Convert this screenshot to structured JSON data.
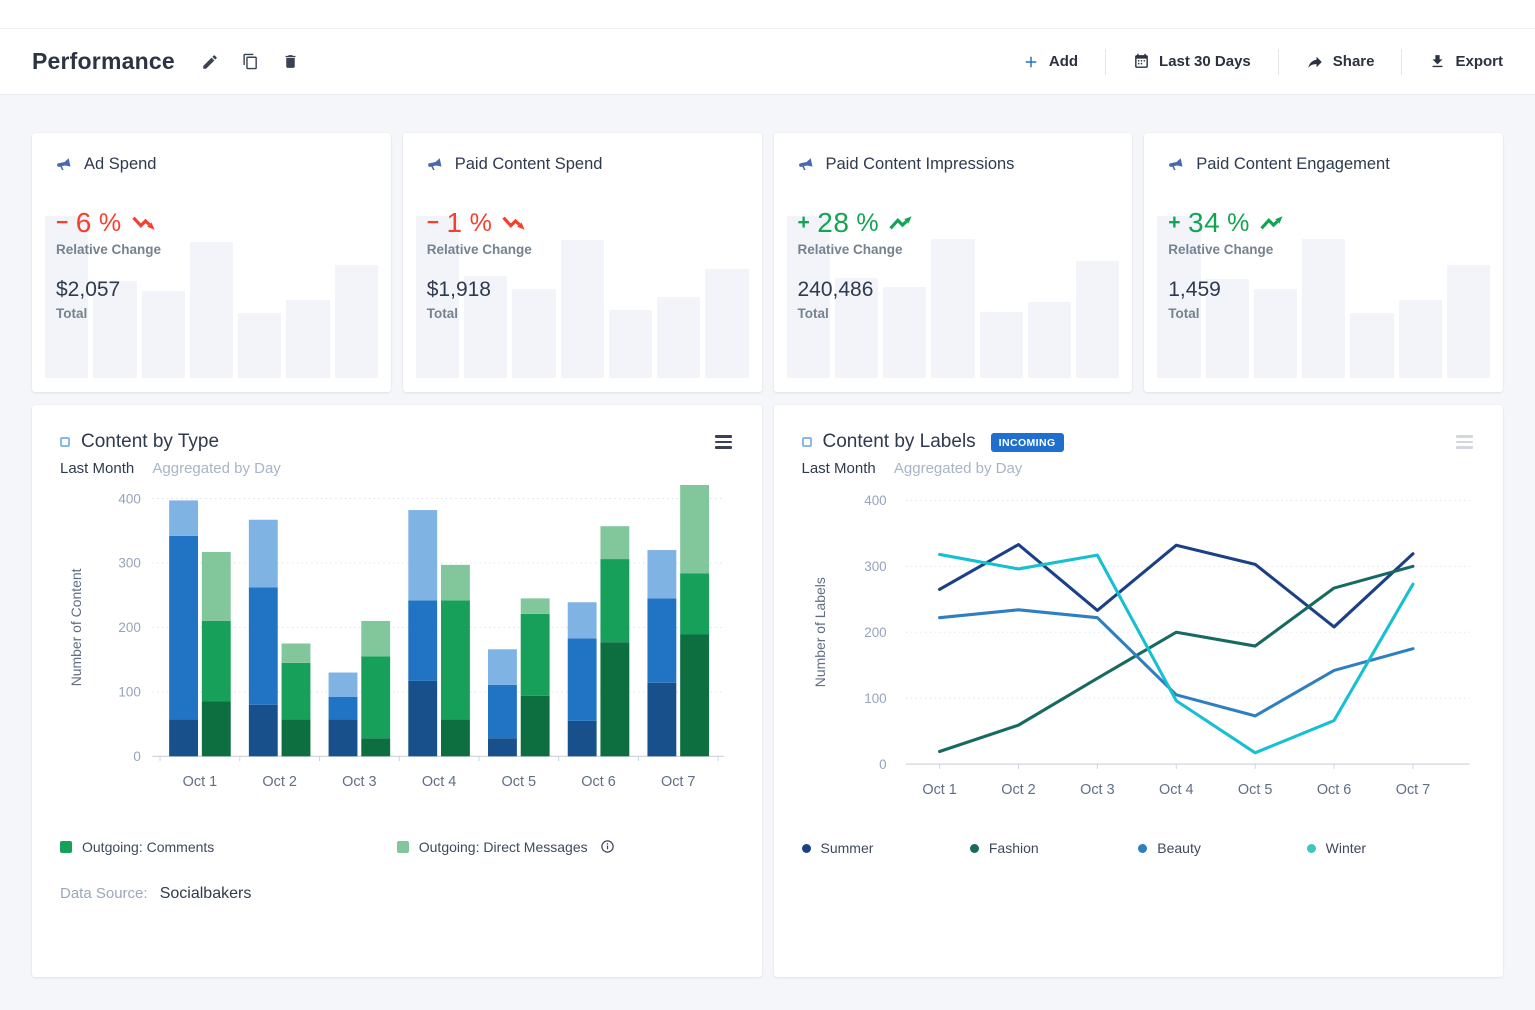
{
  "header": {
    "title": "Performance",
    "actions": {
      "add": "Add",
      "date_range": "Last 30 Days",
      "share": "Share",
      "export": "Export"
    }
  },
  "colors": {
    "accent_blue": "#2173c4",
    "negative_red": "#f4402f",
    "positive_green": "#13a453",
    "badge_blue": "#1e6fce",
    "kpi_icon_blue": "#4a69ad",
    "spark_gray": "#f2f4f9"
  },
  "icons": {
    "edit": "pencil",
    "duplicate": "two-overlapping-squares",
    "delete": "trash-can",
    "add": "plus",
    "date_range": "calendar",
    "share": "curved-arrow-right",
    "export": "download-arrow",
    "kpi": "megaphone",
    "chart_menu": "hamburger",
    "widget_select": "outlined-square",
    "info": "circled-i",
    "trend_down": "zigzag-arrow-down",
    "trend_up": "zigzag-arrow-up"
  },
  "kpi_cards": [
    {
      "title": "Ad Spend",
      "sign": "−",
      "value": "6",
      "suffix": "%",
      "direction": "down",
      "color": "#f4402f",
      "change_label": "Relative Change",
      "total": "$2,057",
      "total_label": "Total",
      "sparkline": [
        1,
        0.6,
        0.54,
        0.84,
        0.4,
        0.48,
        0.7
      ]
    },
    {
      "title": "Paid Content Spend",
      "sign": "−",
      "value": "1",
      "suffix": "%",
      "direction": "down",
      "color": "#f4402f",
      "change_label": "Relative Change",
      "total": "$1,918",
      "total_label": "Total",
      "sparkline": [
        1,
        0.63,
        0.55,
        0.85,
        0.42,
        0.5,
        0.67
      ]
    },
    {
      "title": "Paid Content Impressions",
      "sign": "+",
      "value": "28",
      "suffix": "%",
      "direction": "up",
      "color": "#13a453",
      "change_label": "Relative Change",
      "total": "240,486",
      "total_label": "Total",
      "sparkline": [
        1,
        0.62,
        0.56,
        0.86,
        0.41,
        0.47,
        0.72
      ]
    },
    {
      "title": "Paid Content Engagement",
      "sign": "+",
      "value": "34",
      "suffix": "%",
      "direction": "up",
      "color": "#13a453",
      "change_label": "Relative Change",
      "total": "1,459",
      "total_label": "Total",
      "sparkline": [
        1,
        0.61,
        0.55,
        0.86,
        0.4,
        0.48,
        0.7
      ]
    }
  ],
  "charts": {
    "content_by_type": {
      "title": "Content by Type",
      "period": "Last Month",
      "aggregation": "Aggregated by Day",
      "legend": [
        {
          "label": "Outgoing: Comments",
          "color": "#16a05a"
        },
        {
          "label": "Outgoing: Direct Messages",
          "color": "#82c79c",
          "info": true
        }
      ],
      "data_source_label": "Data Source:",
      "data_source_value": "Socialbakers"
    },
    "content_by_labels": {
      "title": "Content by Labels",
      "badge": "INCOMING",
      "badge_color": "#1e6fce",
      "period": "Last Month",
      "aggregation": "Aggregated by Day",
      "legend": [
        {
          "label": "Summer",
          "color": "#1c4086"
        },
        {
          "label": "Fashion",
          "color": "#166a60"
        },
        {
          "label": "Beauty",
          "color": "#2d7fc1"
        },
        {
          "label": "Winter",
          "color": "#3cc4c7"
        }
      ]
    }
  },
  "chart_data": [
    {
      "type": "bar",
      "stacked": true,
      "title": "Content by Type",
      "categories": [
        "Oct 1",
        "Oct 2",
        "Oct 3",
        "Oct 4",
        "Oct 5",
        "Oct 6",
        "Oct 7"
      ],
      "ylabel": "Number of Content",
      "ylim": [
        0,
        400
      ],
      "yticks": [
        0,
        100,
        200,
        300,
        400
      ],
      "grid": "dotted-horizontal",
      "groups": [
        {
          "id": "blue-stack",
          "colors": [
            "#17508a",
            "#2173c4",
            "#7fb3e4"
          ],
          "segment_labels": [
            null,
            null,
            null
          ],
          "segments": [
            [
              57,
              80,
              57,
              117,
              28,
              55,
              114
            ],
            [
              285,
              182,
              35,
              125,
              83,
              128,
              131
            ],
            [
              55,
              105,
              38,
              140,
              55,
              56,
              75
            ]
          ]
        },
        {
          "id": "green-stack",
          "colors": [
            "#0d6e3f",
            "#16a05a",
            "#82c79c"
          ],
          "segment_labels": [
            null,
            "Outgoing: Comments",
            "Outgoing: Direct Messages"
          ],
          "segments": [
            [
              85,
              57,
              28,
              57,
              94,
              177,
              189
            ],
            [
              125,
              88,
              127,
              185,
              127,
              129,
              95
            ],
            [
              107,
              30,
              55,
              55,
              24,
              51,
              141
            ]
          ]
        }
      ]
    },
    {
      "type": "line",
      "title": "Content by Labels",
      "x": [
        "Oct 1",
        "Oct 2",
        "Oct 3",
        "Oct 4",
        "Oct 5",
        "Oct 6",
        "Oct 7"
      ],
      "ylabel": "Number of Labels",
      "ylim": [
        0,
        400
      ],
      "yticks": [
        0,
        100,
        200,
        300,
        400
      ],
      "grid": "dotted-horizontal",
      "legend_position": "bottom",
      "series": [
        {
          "name": "Summer",
          "color": "#1c4086",
          "values": [
            265,
            333,
            233,
            332,
            303,
            208,
            319
          ]
        },
        {
          "name": "Fashion",
          "color": "#166a60",
          "values": [
            19,
            59,
            130,
            200,
            179,
            267,
            300
          ]
        },
        {
          "name": "Beauty",
          "color": "#2d7fc1",
          "values": [
            222,
            234,
            222,
            105,
            73,
            142,
            175
          ]
        },
        {
          "name": "Winter",
          "color": "#17bfd3",
          "values": [
            318,
            296,
            317,
            96,
            17,
            66,
            273
          ]
        }
      ]
    }
  ]
}
